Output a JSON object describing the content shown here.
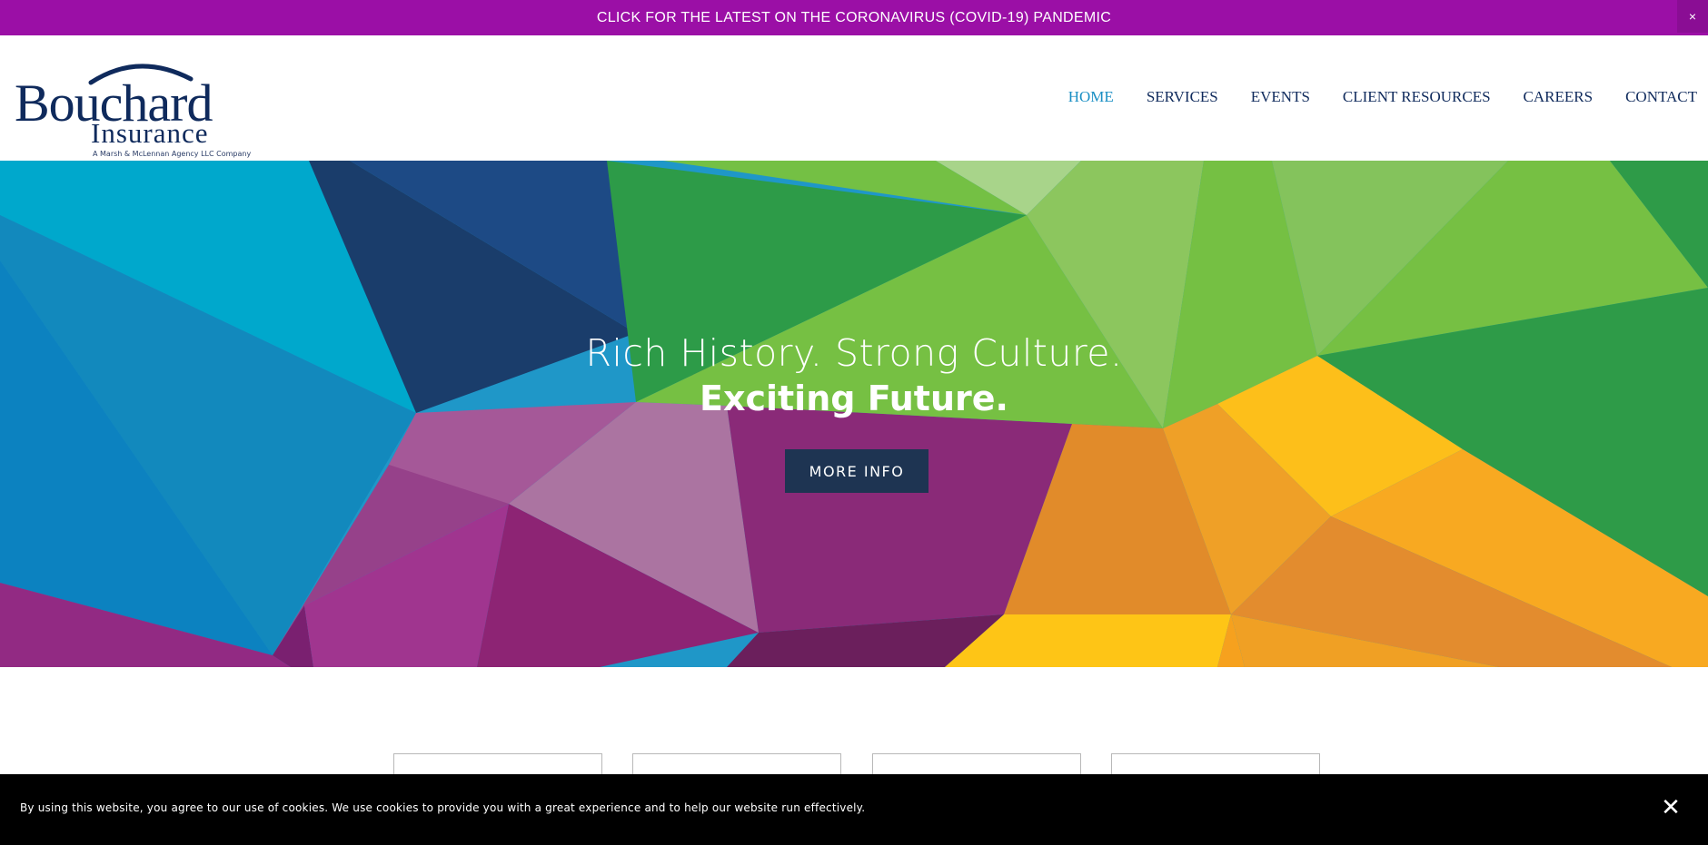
{
  "banner": {
    "text": "CLICK FOR THE LATEST ON THE CORONAVIRUS (COVID-19) PANDEMIC",
    "close_glyph": "×",
    "background": "#9b0fa6"
  },
  "logo": {
    "name": "Bouchard",
    "sub": "Insurance",
    "tagline": "A Marsh & McLennan Agency LLC Company",
    "icon": "arc-swoosh-icon"
  },
  "nav": {
    "items": [
      {
        "label": "HOME",
        "active": true
      },
      {
        "label": "SERVICES",
        "active": false
      },
      {
        "label": "EVENTS",
        "active": false
      },
      {
        "label": "CLIENT RESOURCES",
        "active": false
      },
      {
        "label": "CAREERS",
        "active": false
      },
      {
        "label": "CONTACT",
        "active": false
      }
    ],
    "active_color": "#1a8fc4",
    "color": "#0f2a5c"
  },
  "hero": {
    "line1": "Rich History. Strong Culture.",
    "line2": "Exciting Future.",
    "button": "MORE INFO"
  },
  "cookie": {
    "text": "By using this website, you agree to our use of cookies. We use cookies to provide you with a great experience and to help our website run effectively.",
    "close_glyph": "✕"
  }
}
